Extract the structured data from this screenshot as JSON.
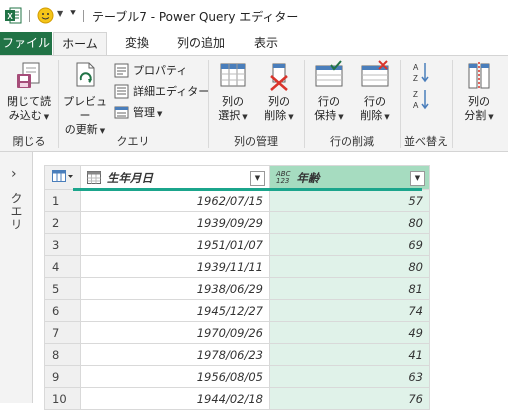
{
  "titlebar": {
    "title": "テーブル7 - Power Query エディター",
    "app_icon": "excel-icon",
    "quick_icon": "smiley-icon"
  },
  "tabs": [
    "ファイル",
    "ホーム",
    "変換",
    "列の追加",
    "表示"
  ],
  "ribbon": {
    "groups": {
      "close": "閉じる",
      "query": "クエリ",
      "manage_cols": "列の管理",
      "reduce_rows": "行の削減",
      "sort": "並べ替え"
    },
    "close_load": [
      "閉じて読",
      "み込む"
    ],
    "preview_refresh": [
      "プレビュー",
      "の更新"
    ],
    "properties": "プロパティ",
    "advanced_editor": "詳細エディター",
    "manage": "管理",
    "choose_cols": [
      "列の",
      "選択"
    ],
    "remove_cols": [
      "列の",
      "削除"
    ],
    "keep_rows": [
      "行の",
      "保持"
    ],
    "remove_rows": [
      "行の",
      "削除"
    ],
    "split_col": [
      "列の",
      "分割"
    ]
  },
  "queries_pane": {
    "label": "クエリ"
  },
  "table": {
    "columns": [
      {
        "name": "生年月日",
        "type_icon": "calendar-icon"
      },
      {
        "name": "年齢",
        "type_label": "ABC\n123"
      }
    ],
    "rows": [
      {
        "n": "1",
        "birth": "1962/07/15",
        "age": "57"
      },
      {
        "n": "2",
        "birth": "1939/09/29",
        "age": "80"
      },
      {
        "n": "3",
        "birth": "1951/01/07",
        "age": "69"
      },
      {
        "n": "4",
        "birth": "1939/11/11",
        "age": "80"
      },
      {
        "n": "5",
        "birth": "1938/06/29",
        "age": "81"
      },
      {
        "n": "6",
        "birth": "1945/12/27",
        "age": "74"
      },
      {
        "n": "7",
        "birth": "1970/09/26",
        "age": "49"
      },
      {
        "n": "8",
        "birth": "1978/06/23",
        "age": "41"
      },
      {
        "n": "9",
        "birth": "1956/08/05",
        "age": "63"
      },
      {
        "n": "10",
        "birth": "1944/02/18",
        "age": "76"
      }
    ]
  },
  "colors": {
    "file_tab": "#217346",
    "selected_column": "#a6dcc0",
    "selected_cells": "#e0f2e9",
    "column_accent": "#1ba58c"
  }
}
